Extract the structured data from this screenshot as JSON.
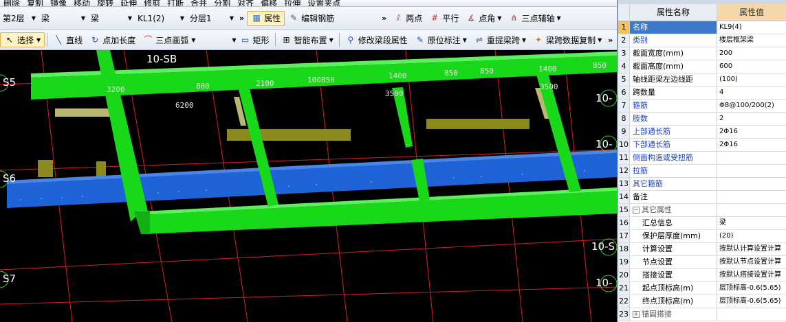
{
  "toolbar_top": {
    "items": [
      "删除",
      "复制",
      "镜像",
      "移动",
      "旋转",
      "延伸",
      "修剪",
      "打断",
      "合并",
      "分割",
      "对齐",
      "偏移",
      "拉伸",
      "设置夹点"
    ]
  },
  "toolbar1": {
    "floor": "第2层",
    "category": "梁",
    "type": "梁",
    "element": "KL1(2)",
    "layer": "分层1",
    "property_btn": "属性",
    "edit_rebar_btn": "编辑钢筋",
    "two_point": "两点",
    "parallel": "平行",
    "point_angle": "点角",
    "three_point_axis": "三点辅轴"
  },
  "toolbar2": {
    "select": "选择",
    "line": "直线",
    "point_length": "点加长度",
    "three_point_arc": "三点画弧",
    "rect": "矩形",
    "smart_layout": "智能布置",
    "modify_span": "修改梁段属性",
    "original_label": "原位标注",
    "re_extract": "重提梁跨",
    "copy_span_data": "梁跨数据复制"
  },
  "viewport": {
    "axis_labels": [
      "10-SB",
      "S5",
      "S6",
      "S7",
      "10-",
      "10-",
      "10-S",
      "10-"
    ],
    "dims": [
      "3200",
      "800",
      "2100",
      "100850",
      "1400",
      "850",
      "850",
      "1400",
      "850",
      "6200",
      "3500",
      "3500"
    ],
    "colors": {
      "frame_beam": "#19d719",
      "blue_beam": "#1e64d8",
      "olive_beam": "#8a8a1e",
      "axis": "#d92020",
      "background": "#000000"
    }
  },
  "panel": {
    "header_name": "属性名称",
    "header_value": "属性值",
    "rows": [
      {
        "num": "1",
        "name": "名称",
        "value": "KL9(4)"
      },
      {
        "num": "2",
        "name": "类别",
        "value": "楼层框架梁"
      },
      {
        "num": "3",
        "name": "截面宽度(mm)",
        "value": "200"
      },
      {
        "num": "4",
        "name": "截面高度(mm)",
        "value": "600"
      },
      {
        "num": "5",
        "name": "轴线距梁左边线距",
        "value": "(100)"
      },
      {
        "num": "6",
        "name": "跨数量",
        "value": "4"
      },
      {
        "num": "7",
        "name": "箍筋",
        "value": "Φ8@100/200(2)"
      },
      {
        "num": "8",
        "name": "肢数",
        "value": "2"
      },
      {
        "num": "9",
        "name": "上部通长筋",
        "value": "2Φ16"
      },
      {
        "num": "10",
        "name": "下部通长筋",
        "value": "2Φ16"
      },
      {
        "num": "11",
        "name": "侧面构造或受扭筋",
        "value": ""
      },
      {
        "num": "12",
        "name": "拉筋",
        "value": ""
      },
      {
        "num": "13",
        "name": "其它箍筋",
        "value": ""
      },
      {
        "num": "14",
        "name": "备注",
        "value": ""
      },
      {
        "num": "15",
        "name": "其它属性",
        "value": ""
      },
      {
        "num": "16",
        "name": "汇总信息",
        "value": "梁"
      },
      {
        "num": "17",
        "name": "保护层厚度(mm)",
        "value": "(20)"
      },
      {
        "num": "18",
        "name": "计算设置",
        "value": "按默认计算设置计算"
      },
      {
        "num": "19",
        "name": "节点设置",
        "value": "按默认节点设置计算"
      },
      {
        "num": "20",
        "name": "搭接设置",
        "value": "按默认搭接设置计算"
      },
      {
        "num": "21",
        "name": "起点顶标高(m)",
        "value": "层顶标高-0.6(5.65)"
      },
      {
        "num": "22",
        "name": "终点顶标高(m)",
        "value": "层顶标高-0.6(5.65)"
      },
      {
        "num": "23",
        "name": "锚固搭接",
        "value": ""
      }
    ]
  }
}
